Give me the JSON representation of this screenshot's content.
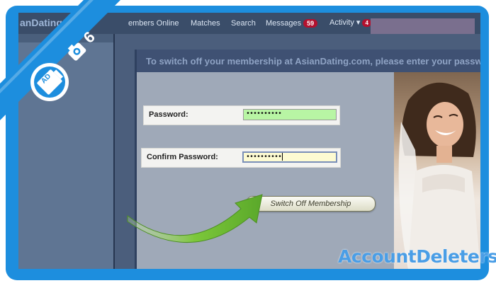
{
  "nav": {
    "logo": "anDating",
    "items": [
      "embers Online",
      "Matches",
      "Search"
    ],
    "messages_label": "Messages",
    "messages_count": "59",
    "activity_label": "Activity",
    "activity_caret": "▾",
    "activity_count": "4"
  },
  "instruction": "To switch off your membership at AsianDating.com, please enter your passw",
  "form": {
    "password_label": "Password:",
    "password_value": "••••••••••",
    "confirm_label": "Confirm Password:",
    "confirm_value": "••••••••••",
    "submit_label": "Switch Off Membership"
  },
  "step_badge": {
    "step": "6",
    "logo_text": "AD",
    "icon": "camera-icon"
  },
  "watermark": "AccountDeleters",
  "colors": {
    "frame": "#1d8ede",
    "arrow": "#7cc73a",
    "badge": "#b3112e",
    "password_ok": "#b8f5a4"
  }
}
